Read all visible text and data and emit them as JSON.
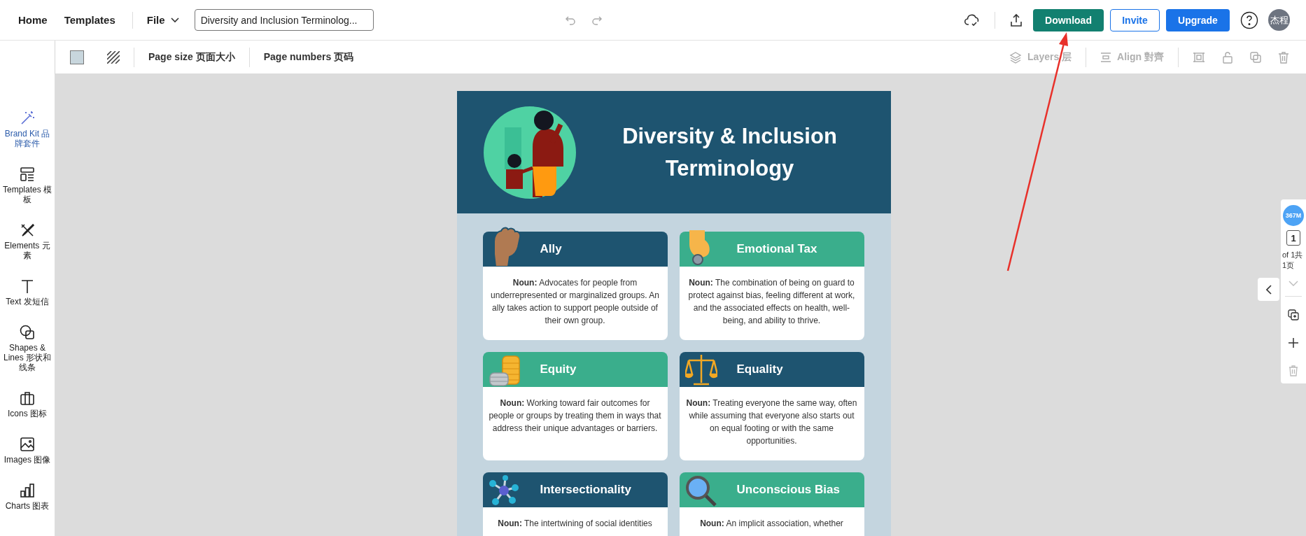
{
  "top_bar": {
    "nav": [
      {
        "label": "Home"
      },
      {
        "label": "Templates"
      }
    ],
    "file_menu": "File",
    "document_title": "Diversity and Inclusion Terminolog...",
    "buttons": [
      {
        "label": "Download",
        "kind": "download"
      },
      {
        "label": "Invite",
        "kind": "outline"
      },
      {
        "label": "Upgrade",
        "kind": "solid"
      }
    ],
    "avatar": "杰程"
  },
  "toolbar": {
    "page_size": "Page size 页面大小",
    "page_numbers": "Page numbers 页码",
    "layers": {
      "label": "Layers 层",
      "disabled": true
    },
    "align": {
      "label": "Align 對齊",
      "disabled": true
    }
  },
  "sidebar": {
    "items": [
      {
        "label": "Brand Kit 品牌套件",
        "selected": true
      },
      {
        "label": "Templates 模板",
        "selected": false
      },
      {
        "label": "Elements 元素",
        "selected": false
      },
      {
        "label": "Text 发短信",
        "selected": false
      },
      {
        "label": "Shapes & Lines 形状和线条",
        "selected": false
      },
      {
        "label": "Icons 图标",
        "selected": false
      },
      {
        "label": "Images 图像",
        "selected": false
      },
      {
        "label": "Charts 图表",
        "selected": false
      }
    ]
  },
  "infographic": {
    "title": "Diversity & Inclusion Terminology",
    "cards": [
      {
        "term": "Ally",
        "definition": "**Noun:** Advocates for people from underrepresented or marginalized groups. An ally takes action to support people outside of their own group.",
        "color": "#1e5470"
      },
      {
        "term": "Emotional Tax",
        "definition": "**Noun:** The combination of being on guard to protect against bias, feeling different at work, and the associated effects on health, well-being, and ability to thrive.",
        "color": "#3aae8c"
      },
      {
        "term": "Equity",
        "definition": "**Noun:** Working toward fair outcomes for people or groups by treating them in ways that address their unique advantages or barriers.",
        "color": "#3aae8c"
      },
      {
        "term": "Equality",
        "definition": "**Noun:** Treating everyone the same way, often while assuming that everyone also starts out on equal footing or with the same opportunities.",
        "color": "#1e5470"
      },
      {
        "term": "Intersectionality",
        "definition": "**Noun:** The intertwining of social identities",
        "color": "#1e5470"
      },
      {
        "term": "Unconscious Bias",
        "definition": "**Noun:** An implicit association, whether",
        "color": "#3aae8c"
      }
    ]
  },
  "page_panel": {
    "file_size": "367M",
    "page_number": "1",
    "page_count": "of 1共1页"
  }
}
